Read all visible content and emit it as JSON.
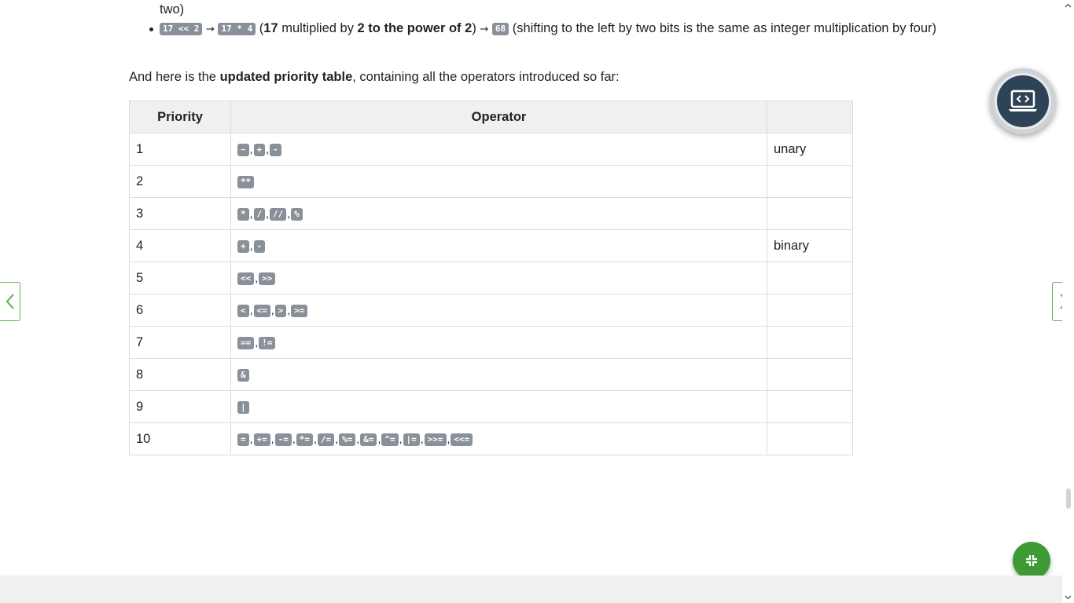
{
  "bullets": {
    "top_line_tail": "two)",
    "item": {
      "expr": "17 << 2",
      "arrow1": "→",
      "equiv": "17 * 4",
      "open_paren": "(",
      "n17": "17",
      "mult_text": " multiplied by ",
      "power_text": "2 to the power of 2",
      "close_paren": ")",
      "arrow2": "→",
      "result": "68",
      "explanation": "(shifting to the left by two bits is the same as integer multiplication by four)"
    }
  },
  "intro": {
    "prefix": "And here is the ",
    "bold": "updated priority table",
    "suffix": ", containing all the operators introduced so far:"
  },
  "table": {
    "headers": [
      "Priority",
      "Operator",
      ""
    ],
    "rows": [
      {
        "priority": "1",
        "operators": [
          "~",
          "+",
          "-"
        ],
        "note": "unary"
      },
      {
        "priority": "2",
        "operators": [
          "**"
        ],
        "note": ""
      },
      {
        "priority": "3",
        "operators": [
          "*",
          "/",
          "//",
          "%"
        ],
        "note": ""
      },
      {
        "priority": "4",
        "operators": [
          "+",
          "-"
        ],
        "note": "binary"
      },
      {
        "priority": "5",
        "operators": [
          "<<",
          ">>"
        ],
        "note": ""
      },
      {
        "priority": "6",
        "operators": [
          "<",
          "<=",
          ">",
          ">="
        ],
        "note": ""
      },
      {
        "priority": "7",
        "operators": [
          "==",
          "!="
        ],
        "note": ""
      },
      {
        "priority": "8",
        "operators": [
          "&"
        ],
        "note": ""
      },
      {
        "priority": "9",
        "operators": [
          "|"
        ],
        "note": ""
      },
      {
        "priority": "10",
        "operators": [
          "=",
          "+=",
          "-=",
          "*=",
          "/=",
          "%=",
          "&=",
          "^=",
          "|=",
          ">>=",
          "<<="
        ],
        "note": ""
      }
    ]
  },
  "separator": ",",
  "icons": {
    "prev": "chevron-left-icon",
    "next": "chevron-right-icon",
    "sandbox": "laptop-code-icon",
    "collapse": "collapse-icon"
  },
  "colors": {
    "accent_green": "#3d9a34",
    "nav_border": "#5fb04f",
    "code_bg": "#8a9099",
    "sandbox_bg": "#2e4358"
  }
}
